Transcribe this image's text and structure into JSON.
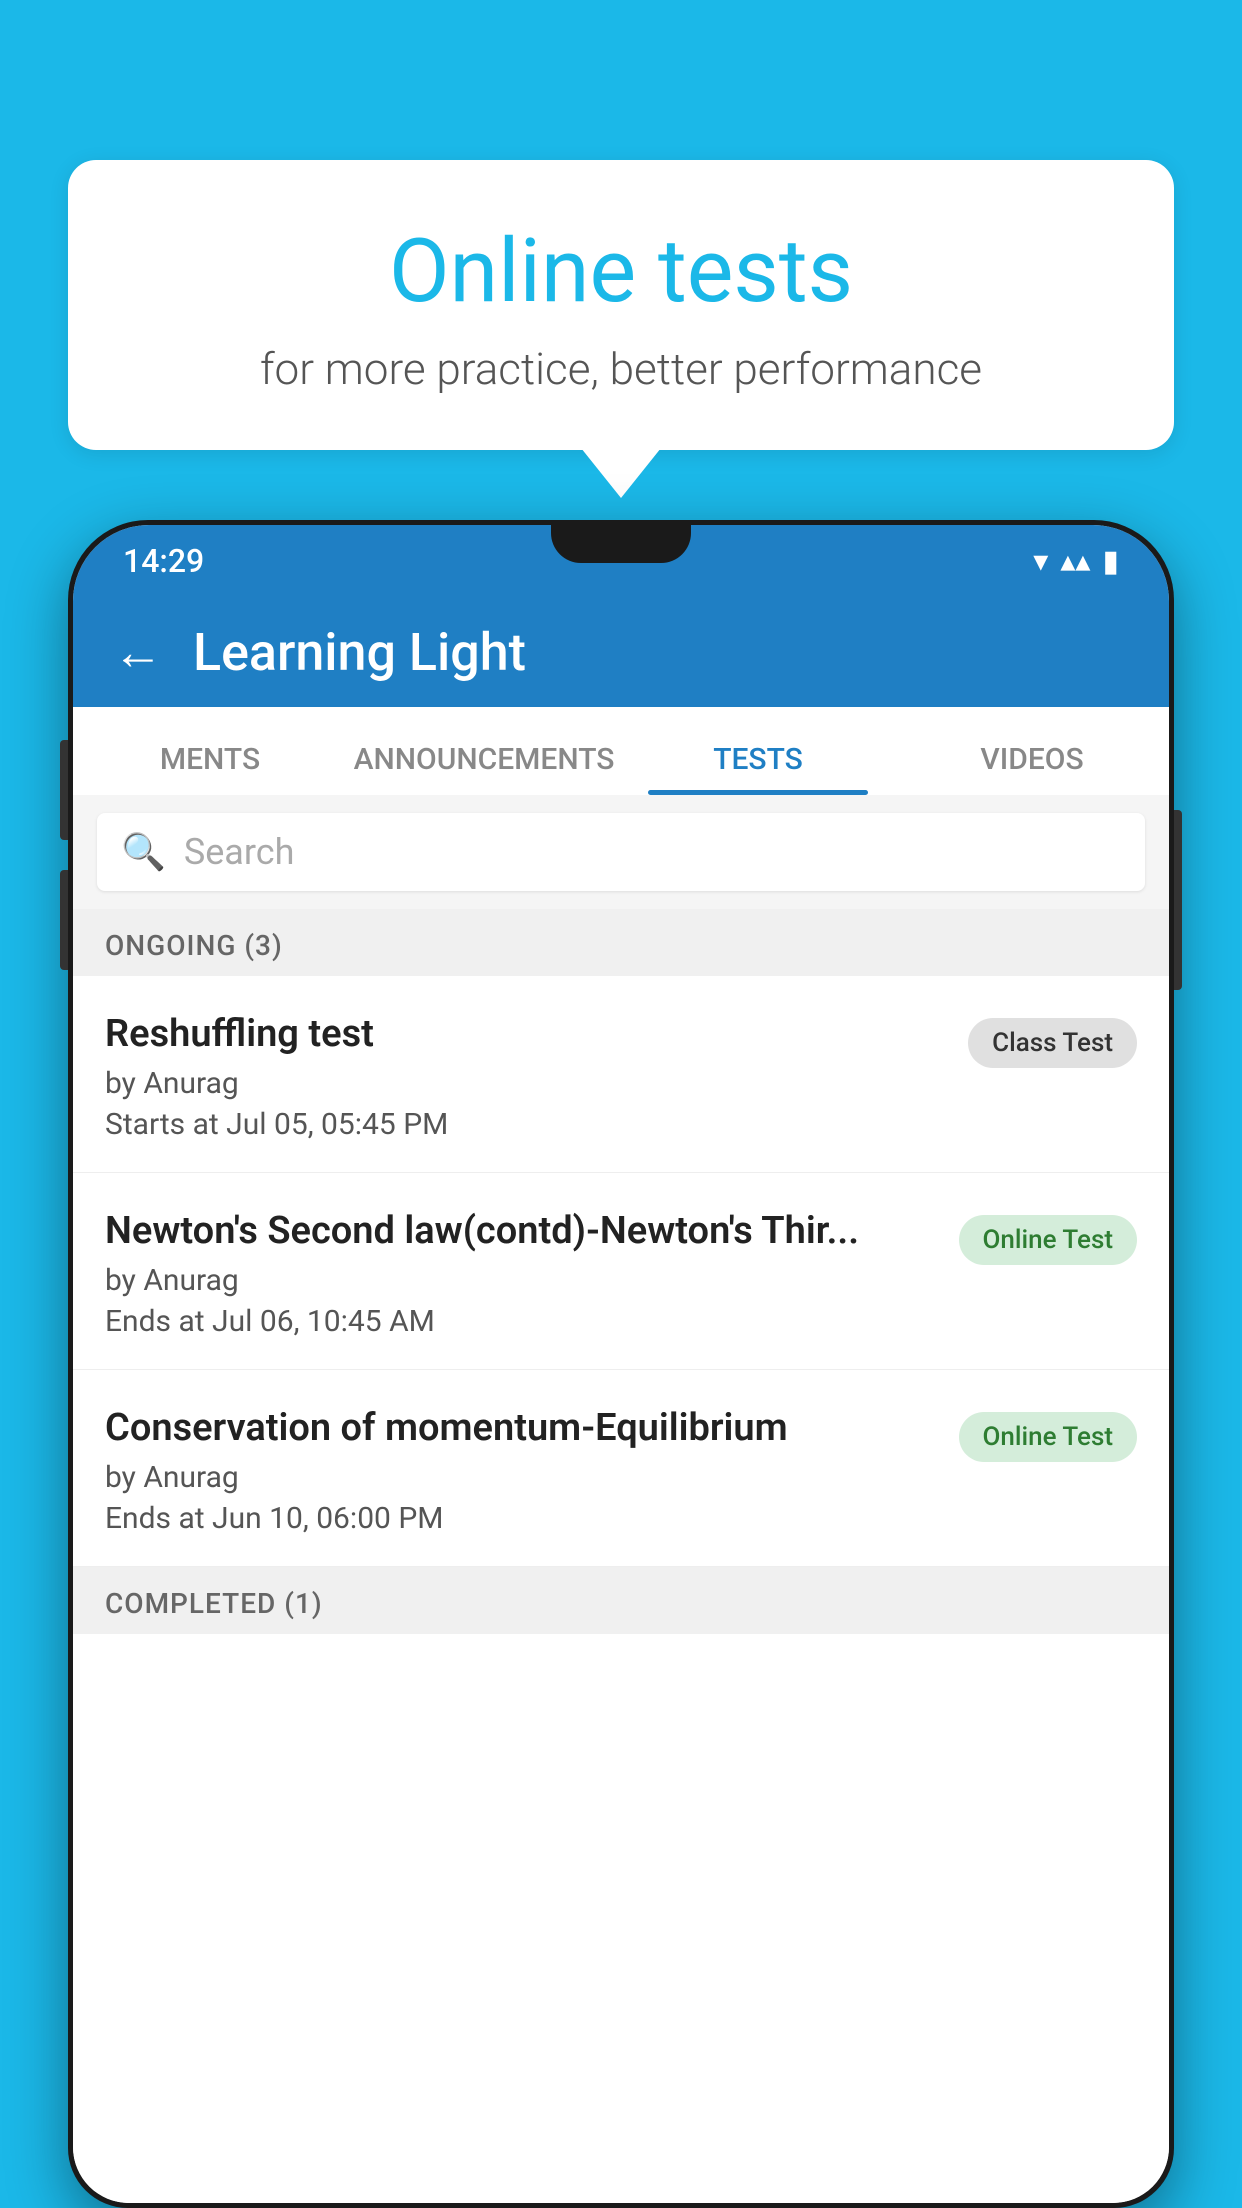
{
  "background": {
    "color": "#1bb8e8"
  },
  "bubble": {
    "title": "Online tests",
    "subtitle": "for more practice, better performance"
  },
  "phone": {
    "status_bar": {
      "time": "14:29",
      "wifi_icon": "▼",
      "signal_icon": "▲",
      "battery_icon": "▮"
    },
    "app_bar": {
      "back_label": "←",
      "title": "Learning Light"
    },
    "tabs": [
      {
        "label": "MENTS",
        "active": false
      },
      {
        "label": "ANNOUNCEMENTS",
        "active": false
      },
      {
        "label": "TESTS",
        "active": true
      },
      {
        "label": "VIDEOS",
        "active": false
      }
    ],
    "search": {
      "placeholder": "Search"
    },
    "ongoing_section": {
      "label": "ONGOING (3)"
    },
    "tests": [
      {
        "name": "Reshuffling test",
        "by": "by Anurag",
        "date": "Starts at  Jul 05, 05:45 PM",
        "badge": "Class Test",
        "badge_type": "class"
      },
      {
        "name": "Newton's Second law(contd)-Newton's Thir...",
        "by": "by Anurag",
        "date": "Ends at  Jul 06, 10:45 AM",
        "badge": "Online Test",
        "badge_type": "online"
      },
      {
        "name": "Conservation of momentum-Equilibrium",
        "by": "by Anurag",
        "date": "Ends at  Jun 10, 06:00 PM",
        "badge": "Online Test",
        "badge_type": "online"
      }
    ],
    "completed_section": {
      "label": "COMPLETED (1)"
    }
  }
}
